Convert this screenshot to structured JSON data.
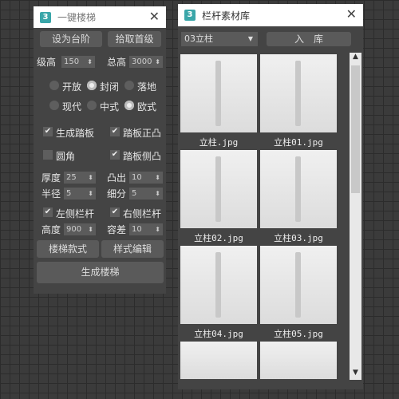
{
  "stair_panel": {
    "title": "一键楼梯",
    "logo": "3",
    "buttons": {
      "set_step": "设为台阶",
      "pick_first": "拾取首级",
      "stair_style": "楼梯款式",
      "style_edit": "样式编辑",
      "generate": "生成楼梯"
    },
    "step_height": {
      "label": "级高",
      "value": "150"
    },
    "total_height": {
      "label": "总高",
      "value": "3000"
    },
    "radios_row1": [
      {
        "label": "开放",
        "checked": false
      },
      {
        "label": "封闭",
        "checked": true
      },
      {
        "label": "落地",
        "checked": false
      }
    ],
    "radios_row2": [
      {
        "label": "现代",
        "checked": false
      },
      {
        "label": "中式",
        "checked": false
      },
      {
        "label": "欧式",
        "checked": true
      }
    ],
    "checks": [
      {
        "label": "生成踏板",
        "checked": true
      },
      {
        "label": "踏板正凸",
        "checked": true
      },
      {
        "label": "圆角",
        "checked": false
      },
      {
        "label": "踏板侧凸",
        "checked": true
      }
    ],
    "thickness": {
      "label": "厚度",
      "value": "25"
    },
    "protrude": {
      "label": "凸出",
      "value": "10"
    },
    "radius": {
      "label": "半径",
      "value": "5"
    },
    "subdiv": {
      "label": "细分",
      "value": "5"
    },
    "left_rail": {
      "label": "左侧栏杆",
      "checked": true
    },
    "right_rail": {
      "label": "右侧栏杆",
      "checked": true
    },
    "height": {
      "label": "高度",
      "value": "900"
    },
    "tolerance": {
      "label": "容差",
      "value": "10"
    }
  },
  "library_panel": {
    "title": "栏杆素材库",
    "logo": "3",
    "category": "03立柱",
    "import_button": "入　库",
    "items": [
      "立柱.jpg",
      "立柱01.jpg",
      "立柱02.jpg",
      "立柱03.jpg",
      "立柱04.jpg",
      "立柱05.jpg"
    ]
  }
}
